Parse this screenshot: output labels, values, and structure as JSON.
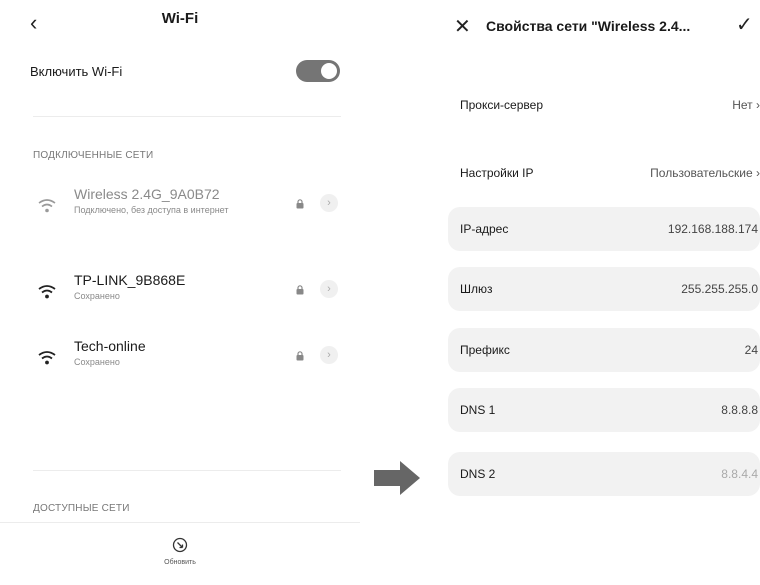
{
  "left": {
    "header": {
      "back_glyph": "‹",
      "title": "Wi-Fi"
    },
    "enable_wifi_label": "Включить Wi-Fi",
    "enable_wifi_on": true,
    "connected_section_label": "ПОДКЛЮЧЕННЫЕ СЕТИ",
    "networks": [
      {
        "name": "Wireless 2.4G_9A0B72",
        "status": "Подключено, без доступа в интернет",
        "dimmed": true
      },
      {
        "name": "TP-LINK_9B868E",
        "status": "Сохранено",
        "dimmed": false
      },
      {
        "name": "Tech-online",
        "status": "Сохранено",
        "dimmed": false
      }
    ],
    "available_section_label": "ДОСТУПНЫЕ СЕТИ",
    "refresh_label": "Обновить"
  },
  "right": {
    "close_glyph": "✕",
    "title": "Свойства сети \"Wireless 2.4...",
    "check_glyph": "✓",
    "proxy": {
      "label": "Прокси-сервер",
      "value": "Нет",
      "chevron": "›"
    },
    "ip_settings": {
      "label": "Настройки IP",
      "value": "Пользовательские",
      "chevron": "›"
    },
    "fields": [
      {
        "label": "IP-адрес",
        "value": "192.168.188.174"
      },
      {
        "label": "Шлюз",
        "value": "255.255.255.0"
      },
      {
        "label": "Префикс",
        "value": "24"
      },
      {
        "label": "DNS 1",
        "value": "8.8.8.8"
      },
      {
        "label": "DNS 2",
        "value": "8.8.4.4",
        "placeholder": true
      }
    ]
  },
  "colors": {
    "toggle_on": "#757575",
    "field_bg": "#f2f2f2",
    "arrow": "#666666"
  }
}
